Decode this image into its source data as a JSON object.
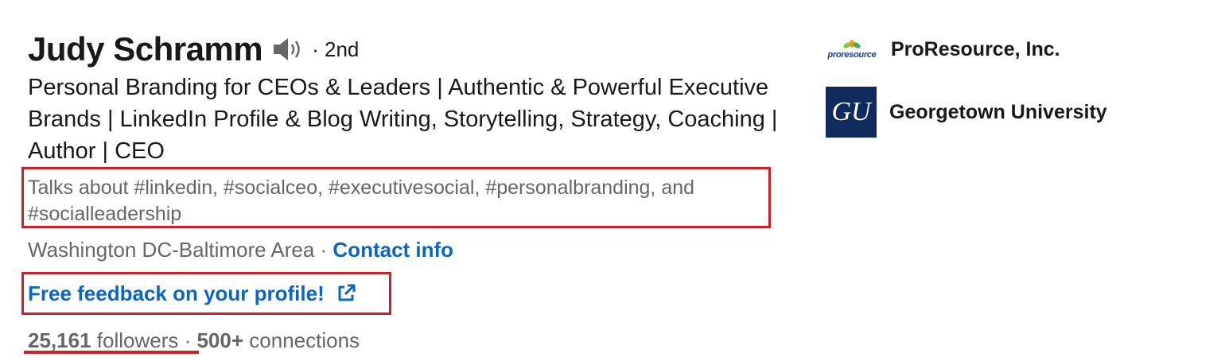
{
  "profile": {
    "name": "Judy Schramm",
    "degree": "· 2nd",
    "headline": "Personal Branding for CEOs & Leaders | Authentic & Powerful Executive Brands | LinkedIn Profile & Blog Writing, Storytelling, Strategy, Coaching | Author | CEO",
    "talks_about": "Talks about #linkedin, #socialceo, #executivesocial, #personalbranding, and #socialleadership",
    "location": "Washington DC-Baltimore Area",
    "location_sep": " · ",
    "contact_info": "Contact info",
    "feedback_link": "Free feedback on your profile!",
    "followers_count": "25,161",
    "followers_label": "followers",
    "stats_sep": " · ",
    "connections_count": "500+",
    "connections_label": "connections"
  },
  "organizations": [
    {
      "name": "ProResource, Inc.",
      "logo_text": "proresource",
      "icon": "proresource-logo"
    },
    {
      "name": "Georgetown University",
      "logo_text": "GU",
      "icon": "georgetown-logo"
    }
  ],
  "colors": {
    "link": "#0a66c2",
    "highlight": "#d21f26",
    "muted": "#666666"
  }
}
